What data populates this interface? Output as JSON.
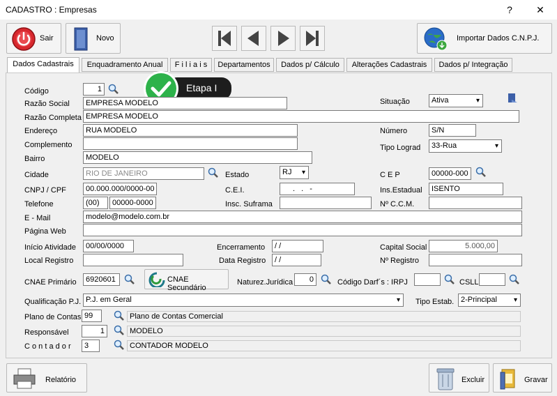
{
  "window": {
    "title": "CADASTRO : Empresas",
    "help": "?",
    "close": "✕"
  },
  "toolbar": {
    "sair": "Sair",
    "novo": "Novo",
    "importar": "Importar Dados C.N.P.J."
  },
  "tabs": [
    "Dados Cadastrais",
    "Enquadramento Anual",
    "F i l i a i s",
    "Departamentos",
    "Dados p/ Cálculo",
    "Alterações Cadastrais",
    "Dados p/ Integração"
  ],
  "tooltip": {
    "label": "Etapa I"
  },
  "form": {
    "codigo_label": "Código",
    "codigo": "1",
    "razao_social_label": "Razão Social",
    "razao_social": "EMPRESA MODELO",
    "situacao_label": "Situação",
    "situacao": "Ativa",
    "razao_completa_label": "Razão Completa",
    "razao_completa": "EMPRESA MODELO",
    "endereco_label": "Endereço",
    "endereco": "RUA MODELO",
    "numero_label": "Número",
    "numero": "S/N",
    "complemento_label": "Complemento",
    "complemento": "",
    "tipo_lograd_label": "Tipo Lograd",
    "tipo_lograd": "33-Rua",
    "bairro_label": "Bairro",
    "bairro": "MODELO",
    "cidade_label": "Cidade",
    "cidade": "RIO DE JANEIRO",
    "estado_label": "Estado",
    "estado": "RJ",
    "cep_label": "C E P",
    "cep": "00000-000",
    "cnpj_label": "CNPJ / CPF",
    "cnpj": "00.000.000/0000-00",
    "cei_label": "C.E.I.",
    "cei": ". .  -",
    "ins_estadual_label": "Ins.Estadual",
    "ins_estadual": "ISENTO",
    "telefone_label": "Telefone",
    "ddd": "(00)",
    "telefone": "00000-0000",
    "insc_suframa_label": "Insc. Suframa",
    "insc_suframa": "",
    "ccm_label": "Nº  C.C.M.",
    "ccm": "",
    "email_label": "E - Mail",
    "email": "modelo@modelo.com.br",
    "pagina_web_label": "Página Web",
    "pagina_web": "",
    "inicio_label": "Início Atividade",
    "inicio": "00/00/0000",
    "encerramento_label": "Encerramento",
    "encerramento": " / /",
    "capital_label": "Capital Social",
    "capital": "5.000,00",
    "local_registro_label": "Local Registro",
    "local_registro": "",
    "data_registro_label": "Data Registro",
    "data_registro": " / /",
    "n_registro_label": "Nº Registro",
    "n_registro": "",
    "cnae_label": "CNAE Primário",
    "cnae": "6920601",
    "cnae_sec_button": "CNAE Secundário",
    "natureza_label": "Naturez.Jurídica",
    "natureza": "0",
    "darf_label": "Código Darf´s :  IRPJ",
    "irpj": "",
    "csll_label": "CSLL",
    "csll": "",
    "qualificacao_label": "Qualificação P.J.",
    "qualificacao": "P.J. em Geral",
    "tipo_estab_label": "Tipo Estab.",
    "tipo_estab": "2-Principal",
    "plano_label": "Plano de Contas",
    "plano": "99",
    "plano_desc": "Plano de Contas Comercial",
    "responsavel_label": "Responsável",
    "responsavel": "1",
    "responsavel_desc": "MODELO",
    "contador_label": "C o n t a d o r",
    "contador": "3",
    "contador_desc": "CONTADOR MODELO"
  },
  "bottom": {
    "relatorio": "Relatório",
    "excluir": "Excluir",
    "gravar": "Gravar"
  }
}
